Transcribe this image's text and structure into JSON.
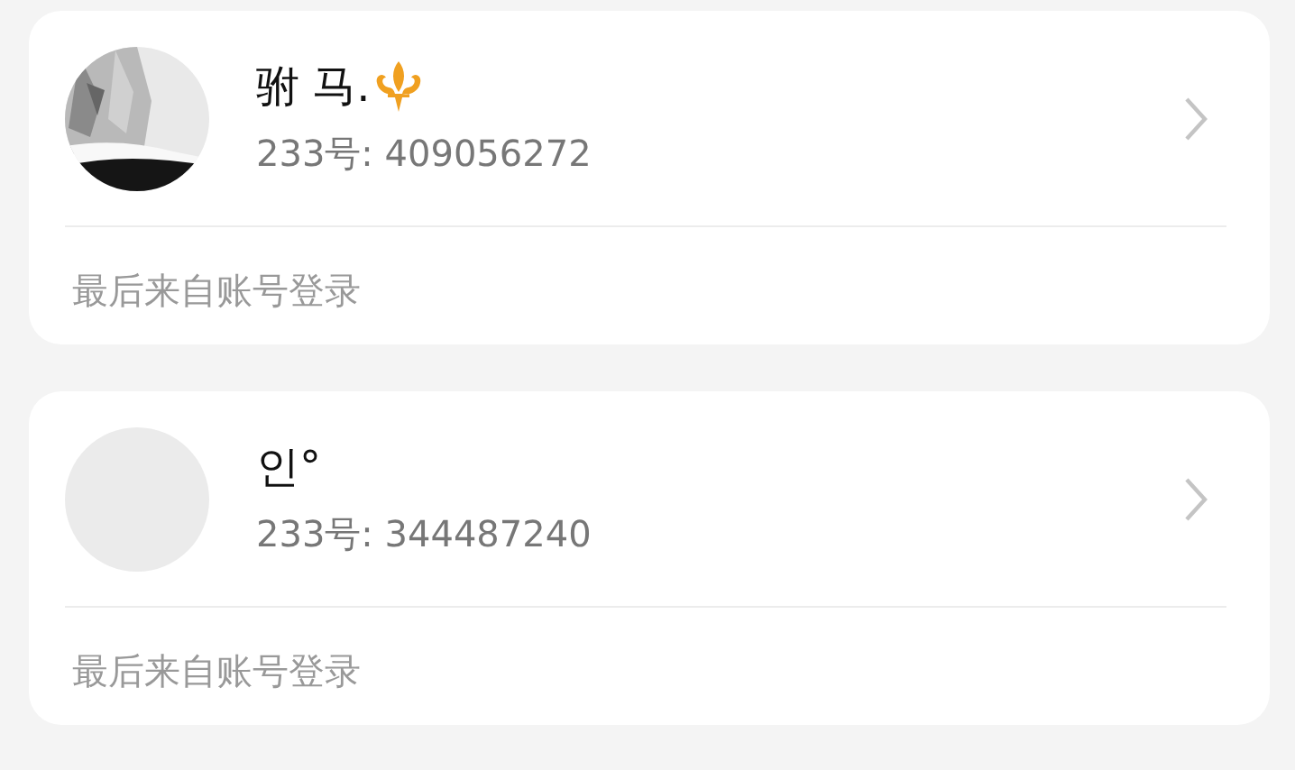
{
  "accounts": [
    {
      "name": "驸 马.",
      "name_badge": true,
      "id_text": "233号: 409056272",
      "footer": "最后来自账号登录"
    },
    {
      "avatar": {
        "kind": "blank"
      },
      "name": "인°",
      "name_badge": false,
      "id_text": "233号: 344487240",
      "footer": "最后来自账号登录"
    }
  ]
}
